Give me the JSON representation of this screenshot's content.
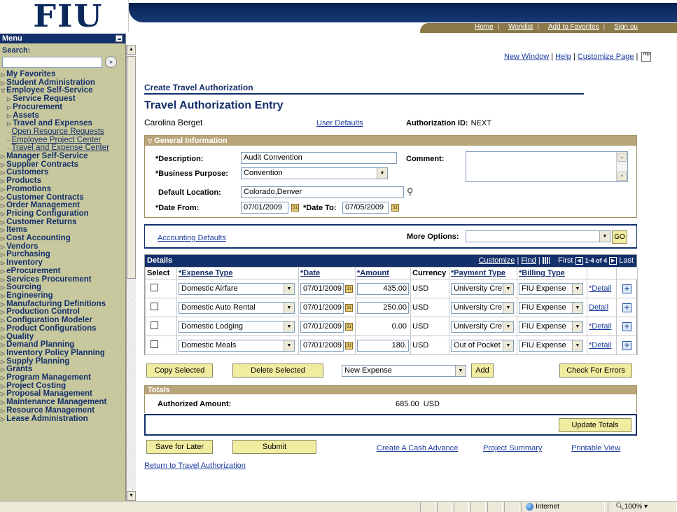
{
  "banner": {
    "logo_text": "FIU",
    "nav": {
      "home": "Home",
      "worklist": "Worklist",
      "add_fav": "Add to Favorites",
      "signout": "Sign ou"
    }
  },
  "menu": {
    "title": "Menu",
    "search_label": "Search:",
    "search_value": "",
    "items": [
      {
        "label": "My Favorites",
        "type": "top"
      },
      {
        "label": "Student Administration",
        "type": "top"
      },
      {
        "label": "Employee Self-Service",
        "type": "open"
      },
      {
        "label": "Service Request",
        "type": "sub"
      },
      {
        "label": "Procurement",
        "type": "sub"
      },
      {
        "label": "Assets",
        "type": "sub"
      },
      {
        "label": "Travel and Expenses",
        "type": "sub"
      },
      {
        "label": "Open Resource Requests",
        "type": "link"
      },
      {
        "label": "Employee Project Center",
        "type": "link"
      },
      {
        "label": "Travel and Expense Center",
        "type": "link"
      },
      {
        "label": "Manager Self-Service",
        "type": "top"
      },
      {
        "label": "Supplier Contracts",
        "type": "top"
      },
      {
        "label": "Customers",
        "type": "top"
      },
      {
        "label": "Products",
        "type": "top"
      },
      {
        "label": "Promotions",
        "type": "top"
      },
      {
        "label": "Customer Contracts",
        "type": "top"
      },
      {
        "label": "Order Management",
        "type": "top"
      },
      {
        "label": "Pricing Configuration",
        "type": "top"
      },
      {
        "label": "Customer Returns",
        "type": "top"
      },
      {
        "label": "Items",
        "type": "top"
      },
      {
        "label": "Cost Accounting",
        "type": "top"
      },
      {
        "label": "Vendors",
        "type": "top"
      },
      {
        "label": "Purchasing",
        "type": "top"
      },
      {
        "label": "Inventory",
        "type": "top"
      },
      {
        "label": "eProcurement",
        "type": "top"
      },
      {
        "label": "Services Procurement",
        "type": "top"
      },
      {
        "label": "Sourcing",
        "type": "top"
      },
      {
        "label": "Engineering",
        "type": "top"
      },
      {
        "label": "Manufacturing Definitions",
        "type": "top"
      },
      {
        "label": "Production Control",
        "type": "top"
      },
      {
        "label": "Configuration Modeler",
        "type": "top"
      },
      {
        "label": "Product Configurations",
        "type": "top"
      },
      {
        "label": "Quality",
        "type": "top"
      },
      {
        "label": "Demand Planning",
        "type": "top"
      },
      {
        "label": "Inventory Policy Planning",
        "type": "top"
      },
      {
        "label": "Supply Planning",
        "type": "top"
      },
      {
        "label": "Grants",
        "type": "top"
      },
      {
        "label": "Program Management",
        "type": "top"
      },
      {
        "label": "Project Costing",
        "type": "top"
      },
      {
        "label": "Proposal Management",
        "type": "top"
      },
      {
        "label": "Maintenance Management",
        "type": "top"
      },
      {
        "label": "Resource Management",
        "type": "top"
      },
      {
        "label": "Lease Administration",
        "type": "top"
      }
    ]
  },
  "toplinks": {
    "new_window": "New Window",
    "help": "Help",
    "customize": "Customize Page",
    "http": "http"
  },
  "page": {
    "breadcrumb": "Create Travel Authorization",
    "title": "Travel Authorization Entry",
    "user_name": "Carolina Berget",
    "user_defaults": "User Defaults",
    "auth_id_label": "Authorization ID:",
    "auth_id_value": "NEXT"
  },
  "general": {
    "header": "General Information",
    "description_label": "*Description:",
    "description_value": "Audit Convention",
    "comment_label": "Comment:",
    "purpose_label": "*Business Purpose:",
    "purpose_value": "Convention",
    "location_label": "Default Location:",
    "location_value": "Colorado,Denver",
    "date_from_label": "*Date From:",
    "date_from_value": "07/01/2009",
    "date_to_label": "*Date To:",
    "date_to_value": "07/05/2009",
    "cal_glyph": "31"
  },
  "accounting": {
    "link": "Accounting Defaults",
    "more_label": "More Options:",
    "more_value": "",
    "go": "GO"
  },
  "details": {
    "title": "Details",
    "customize": "Customize",
    "find": "Find",
    "first": "First",
    "range": "1-4 of 4",
    "last": "Last",
    "columns": [
      "Select",
      "*Expense Type",
      "*Date",
      "*Amount",
      "Currency",
      "*Payment Type",
      "*Billing Type"
    ],
    "rows": [
      {
        "expense": "Domestic Airfare",
        "date": "07/01/2009",
        "amount": "435.00",
        "amount_editable": true,
        "currency": "USD",
        "payment": "University Cre",
        "billing": "FIU Expense",
        "detail": "*Detail"
      },
      {
        "expense": "Domestic Auto Rental",
        "date": "07/01/2009",
        "amount": "250.00",
        "amount_editable": true,
        "currency": "USD",
        "payment": "University Cre",
        "billing": "FIU Expense",
        "detail": "Detail"
      },
      {
        "expense": "Domestic Lodging",
        "date": "07/01/2009",
        "amount": "0.00",
        "amount_editable": false,
        "currency": "USD",
        "payment": "University Cre",
        "billing": "FIU Expense",
        "detail": "*Detail"
      },
      {
        "expense": "Domestic Meals",
        "date": "07/01/2009",
        "amount": "180.",
        "amount_editable": true,
        "currency": "USD",
        "payment": "Out of Pocket",
        "billing": "FIU Expense",
        "detail": "*Detail"
      }
    ]
  },
  "actions": {
    "copy": "Copy Selected",
    "delete": "Delete Selected",
    "new_expense": "New Expense",
    "add": "Add",
    "check": "Check For Errors"
  },
  "totals": {
    "header": "Totals",
    "auth_label": "Authorized Amount:",
    "auth_value": "685.00",
    "auth_currency": "USD",
    "update": "Update Totals"
  },
  "footer": {
    "save": "Save for Later",
    "submit": "Submit",
    "cash_advance": "Create A Cash Advance",
    "project_summary": "Project Summary",
    "printable": "Printable View",
    "return": "Return to Travel Authorization"
  },
  "statusbar": {
    "zone": "Internet",
    "zoom": "100%"
  }
}
